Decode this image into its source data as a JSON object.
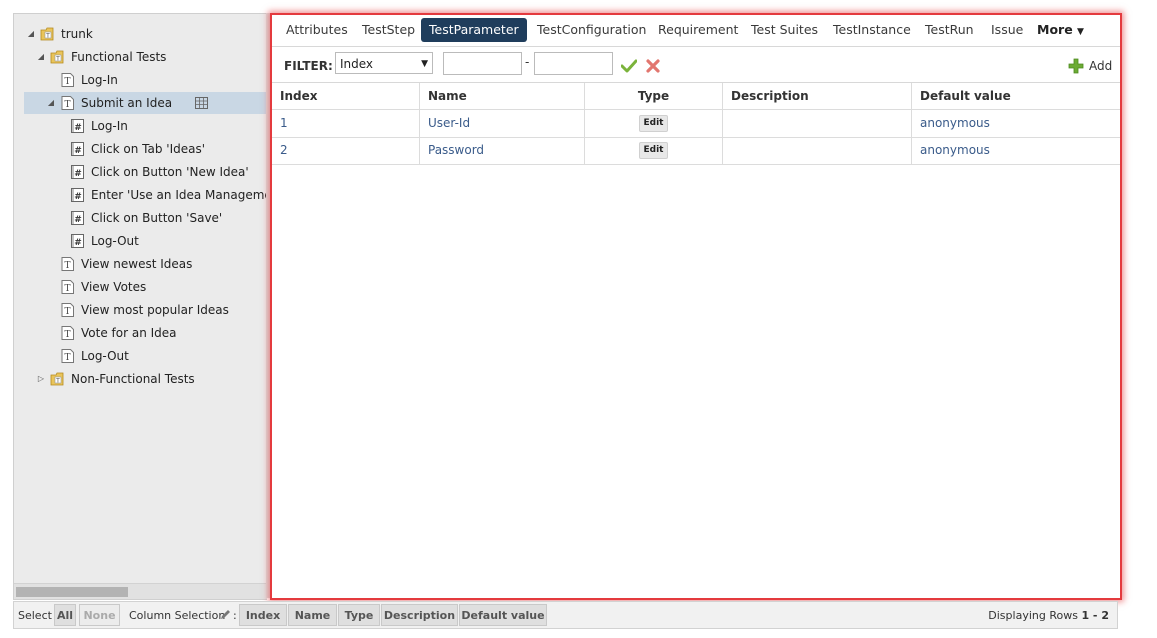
{
  "tree": {
    "nodes": [
      {
        "label": "trunk",
        "icon": "folder-repository-icon",
        "toggle": "expanded"
      },
      {
        "label": "Functional Tests",
        "icon": "folder-test-icon",
        "toggle": "expanded"
      },
      {
        "label": "Log-In",
        "icon": "test-case-icon",
        "toggle": ""
      },
      {
        "label": "Submit an Idea",
        "icon": "test-case-icon",
        "toggle": "expanded",
        "selected": true,
        "extra_icon": "grid-icon"
      },
      {
        "label": "Log-In",
        "icon": "test-step-icon",
        "toggle": ""
      },
      {
        "label": "Click on Tab 'Ideas'",
        "icon": "test-step-icon",
        "toggle": ""
      },
      {
        "label": "Click on Button 'New Idea'",
        "icon": "test-step-icon",
        "toggle": ""
      },
      {
        "label": "Enter 'Use an Idea Management",
        "icon": "test-step-icon",
        "toggle": ""
      },
      {
        "label": "Click on Button 'Save'",
        "icon": "test-step-icon",
        "toggle": ""
      },
      {
        "label": "Log-Out",
        "icon": "test-step-icon",
        "toggle": ""
      },
      {
        "label": "View newest Ideas",
        "icon": "test-case-icon",
        "toggle": ""
      },
      {
        "label": "View Votes",
        "icon": "test-case-icon",
        "toggle": ""
      },
      {
        "label": "View most popular Ideas",
        "icon": "test-case-icon",
        "toggle": ""
      },
      {
        "label": "Vote for an Idea",
        "icon": "test-case-icon",
        "toggle": ""
      },
      {
        "label": "Log-Out",
        "icon": "test-case-icon",
        "toggle": ""
      },
      {
        "label": "Non-Functional Tests",
        "icon": "folder-test-icon",
        "toggle": "collapsed"
      }
    ]
  },
  "tabs": {
    "items": [
      "Attributes",
      "TestStep",
      "TestParameter",
      "TestConfiguration",
      "Requirement",
      "Test Suites",
      "TestInstance",
      "TestRun",
      "Issue"
    ],
    "active": "TestParameter",
    "more_label": "More",
    "more_icon": "caret-down-icon"
  },
  "filter": {
    "label": "FILTER:",
    "field_value": "Index",
    "range_from": "",
    "range_to": "",
    "range_separator": "-",
    "apply_icon": "check-icon",
    "clear_icon": "cross-icon",
    "add_label": "Add",
    "add_icon": "plus-icon"
  },
  "table": {
    "columns": [
      "Index",
      "Name",
      "Type",
      "Description",
      "Default value"
    ],
    "rows": [
      {
        "index": "1",
        "name": "User-Id",
        "type": "Edit",
        "description": "",
        "default_value": "anonymous"
      },
      {
        "index": "2",
        "name": "Password",
        "type": "Edit",
        "description": "",
        "default_value": "anonymous"
      }
    ]
  },
  "bottom": {
    "select_label": "Select",
    "all_label": "All",
    "none_label": "None",
    "column_selection_label": "Column Selection",
    "column_selection_colon": ":",
    "column_buttons": [
      "Index",
      "Name",
      "Type",
      "Description",
      "Default value"
    ],
    "displaying_label": "Displaying Rows",
    "rows_range": "1 - 2"
  },
  "colors": {
    "highlight_border": "#e43a3e",
    "active_tab": "#1f3d5c",
    "selected_tree_row": "#c9d7e4",
    "link_text": "#3a5b8a"
  }
}
